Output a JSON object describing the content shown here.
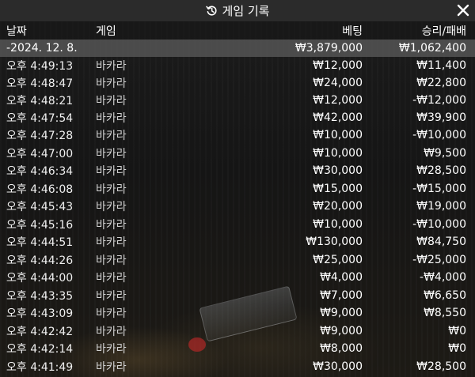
{
  "window": {
    "title": "게임 기록",
    "history_icon": "history-icon",
    "close_icon": "close-icon"
  },
  "columns": {
    "date": "날짜",
    "game": "게임",
    "bet": "베팅",
    "result": "승리/패배"
  },
  "summary": {
    "date": "-2024. 12. 8.",
    "bet": "₩3,879,000",
    "result": "₩1,062,400"
  },
  "rows": [
    {
      "time": "오후 4:49:13",
      "game": "바카라",
      "bet": "₩12,000",
      "result": "₩11,400"
    },
    {
      "time": "오후 4:48:47",
      "game": "바카라",
      "bet": "₩24,000",
      "result": "₩22,800"
    },
    {
      "time": "오후 4:48:21",
      "game": "바카라",
      "bet": "₩12,000",
      "result": "-₩12,000"
    },
    {
      "time": "오후 4:47:54",
      "game": "바카라",
      "bet": "₩42,000",
      "result": "₩39,900"
    },
    {
      "time": "오후 4:47:28",
      "game": "바카라",
      "bet": "₩10,000",
      "result": "-₩10,000"
    },
    {
      "time": "오후 4:47:00",
      "game": "바카라",
      "bet": "₩10,000",
      "result": "₩9,500"
    },
    {
      "time": "오후 4:46:34",
      "game": "바카라",
      "bet": "₩30,000",
      "result": "₩28,500"
    },
    {
      "time": "오후 4:46:08",
      "game": "바카라",
      "bet": "₩15,000",
      "result": "-₩15,000"
    },
    {
      "time": "오후 4:45:43",
      "game": "바카라",
      "bet": "₩20,000",
      "result": "₩19,000"
    },
    {
      "time": "오후 4:45:16",
      "game": "바카라",
      "bet": "₩10,000",
      "result": "-₩10,000"
    },
    {
      "time": "오후 4:44:51",
      "game": "바카라",
      "bet": "₩130,000",
      "result": "₩84,750"
    },
    {
      "time": "오후 4:44:26",
      "game": "바카라",
      "bet": "₩25,000",
      "result": "-₩25,000"
    },
    {
      "time": "오후 4:44:00",
      "game": "바카라",
      "bet": "₩4,000",
      "result": "-₩4,000"
    },
    {
      "time": "오후 4:43:35",
      "game": "바카라",
      "bet": "₩7,000",
      "result": "₩6,650"
    },
    {
      "time": "오후 4:43:09",
      "game": "바카라",
      "bet": "₩9,000",
      "result": "₩8,550"
    },
    {
      "time": "오후 4:42:42",
      "game": "바카라",
      "bet": "₩9,000",
      "result": "₩0"
    },
    {
      "time": "오후 4:42:14",
      "game": "바카라",
      "bet": "₩8,000",
      "result": "₩0"
    },
    {
      "time": "오후 4:41:49",
      "game": "바카라",
      "bet": "₩30,000",
      "result": "₩28,500"
    }
  ]
}
